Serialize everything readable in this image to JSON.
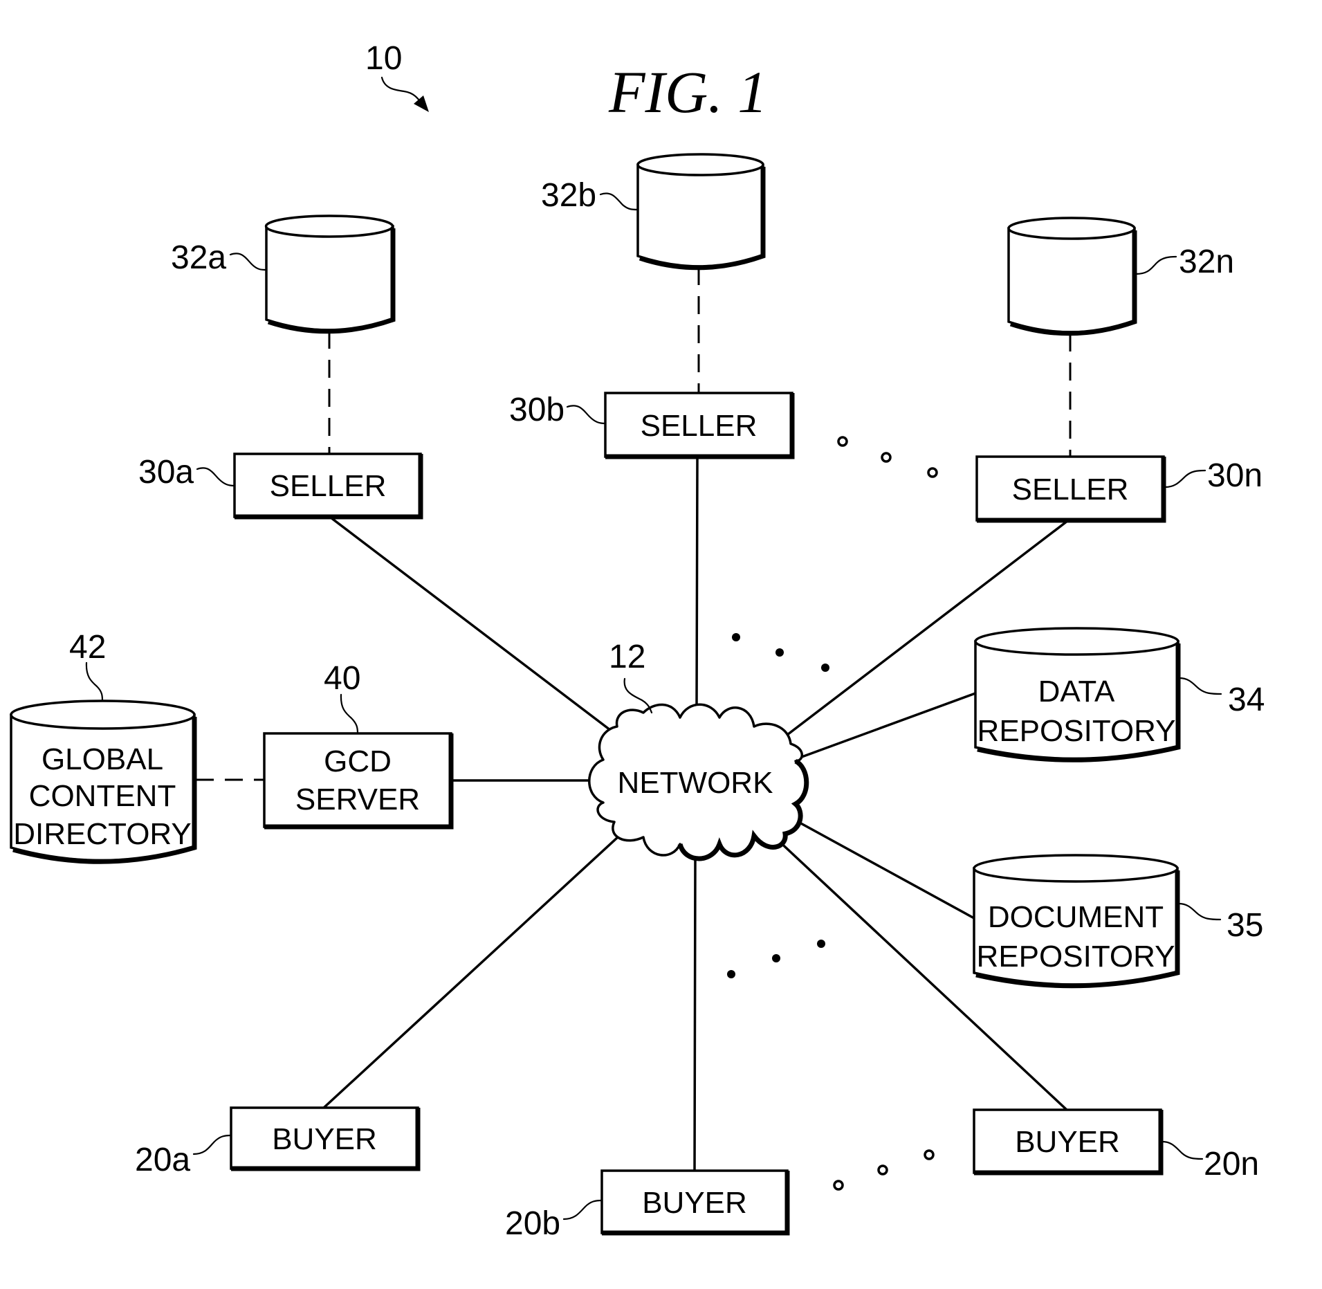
{
  "figure": {
    "title": "FIG. 1",
    "system_ref": "10"
  },
  "network": {
    "label": "NETWORK",
    "ref": "12"
  },
  "sellers": [
    {
      "label": "SELLER",
      "ref": "30a",
      "db_ref": "32a"
    },
    {
      "label": "SELLER",
      "ref": "30b",
      "db_ref": "32b"
    },
    {
      "label": "SELLER",
      "ref": "30n",
      "db_ref": "32n"
    }
  ],
  "buyers": [
    {
      "label": "BUYER",
      "ref": "20a"
    },
    {
      "label": "BUYER",
      "ref": "20b"
    },
    {
      "label": "BUYER",
      "ref": "20n"
    }
  ],
  "gcd_server": {
    "label_lines": [
      "GCD",
      "SERVER"
    ],
    "ref": "40"
  },
  "global_content_directory": {
    "label_lines": [
      "GLOBAL",
      "CONTENT",
      "DIRECTORY"
    ],
    "ref": "42"
  },
  "data_repository": {
    "label_lines": [
      "DATA",
      "REPOSITORY"
    ],
    "ref": "34"
  },
  "document_repository": {
    "label_lines": [
      "DOCUMENT",
      "REPOSITORY"
    ],
    "ref": "35"
  },
  "connections": [
    {
      "from": "30a",
      "to": "12",
      "style": "solid"
    },
    {
      "from": "30b",
      "to": "12",
      "style": "solid"
    },
    {
      "from": "30n",
      "to": "12",
      "style": "solid"
    },
    {
      "from": "34",
      "to": "12",
      "style": "solid"
    },
    {
      "from": "35",
      "to": "12",
      "style": "solid"
    },
    {
      "from": "40",
      "to": "12",
      "style": "solid"
    },
    {
      "from": "20a",
      "to": "12",
      "style": "solid"
    },
    {
      "from": "20b",
      "to": "12",
      "style": "solid"
    },
    {
      "from": "20n",
      "to": "12",
      "style": "solid"
    },
    {
      "from": "32a",
      "to": "30a",
      "style": "dashed"
    },
    {
      "from": "32b",
      "to": "30b",
      "style": "dashed"
    },
    {
      "from": "32n",
      "to": "30n",
      "style": "dashed"
    },
    {
      "from": "42",
      "to": "40",
      "style": "dashed"
    }
  ],
  "ellipsis_markers": {
    "between_sellers": "open-circles",
    "upper_right_of_network": "filled-dots",
    "lower_right_of_network": "filled-dots",
    "between_buyers": "open-circles"
  }
}
